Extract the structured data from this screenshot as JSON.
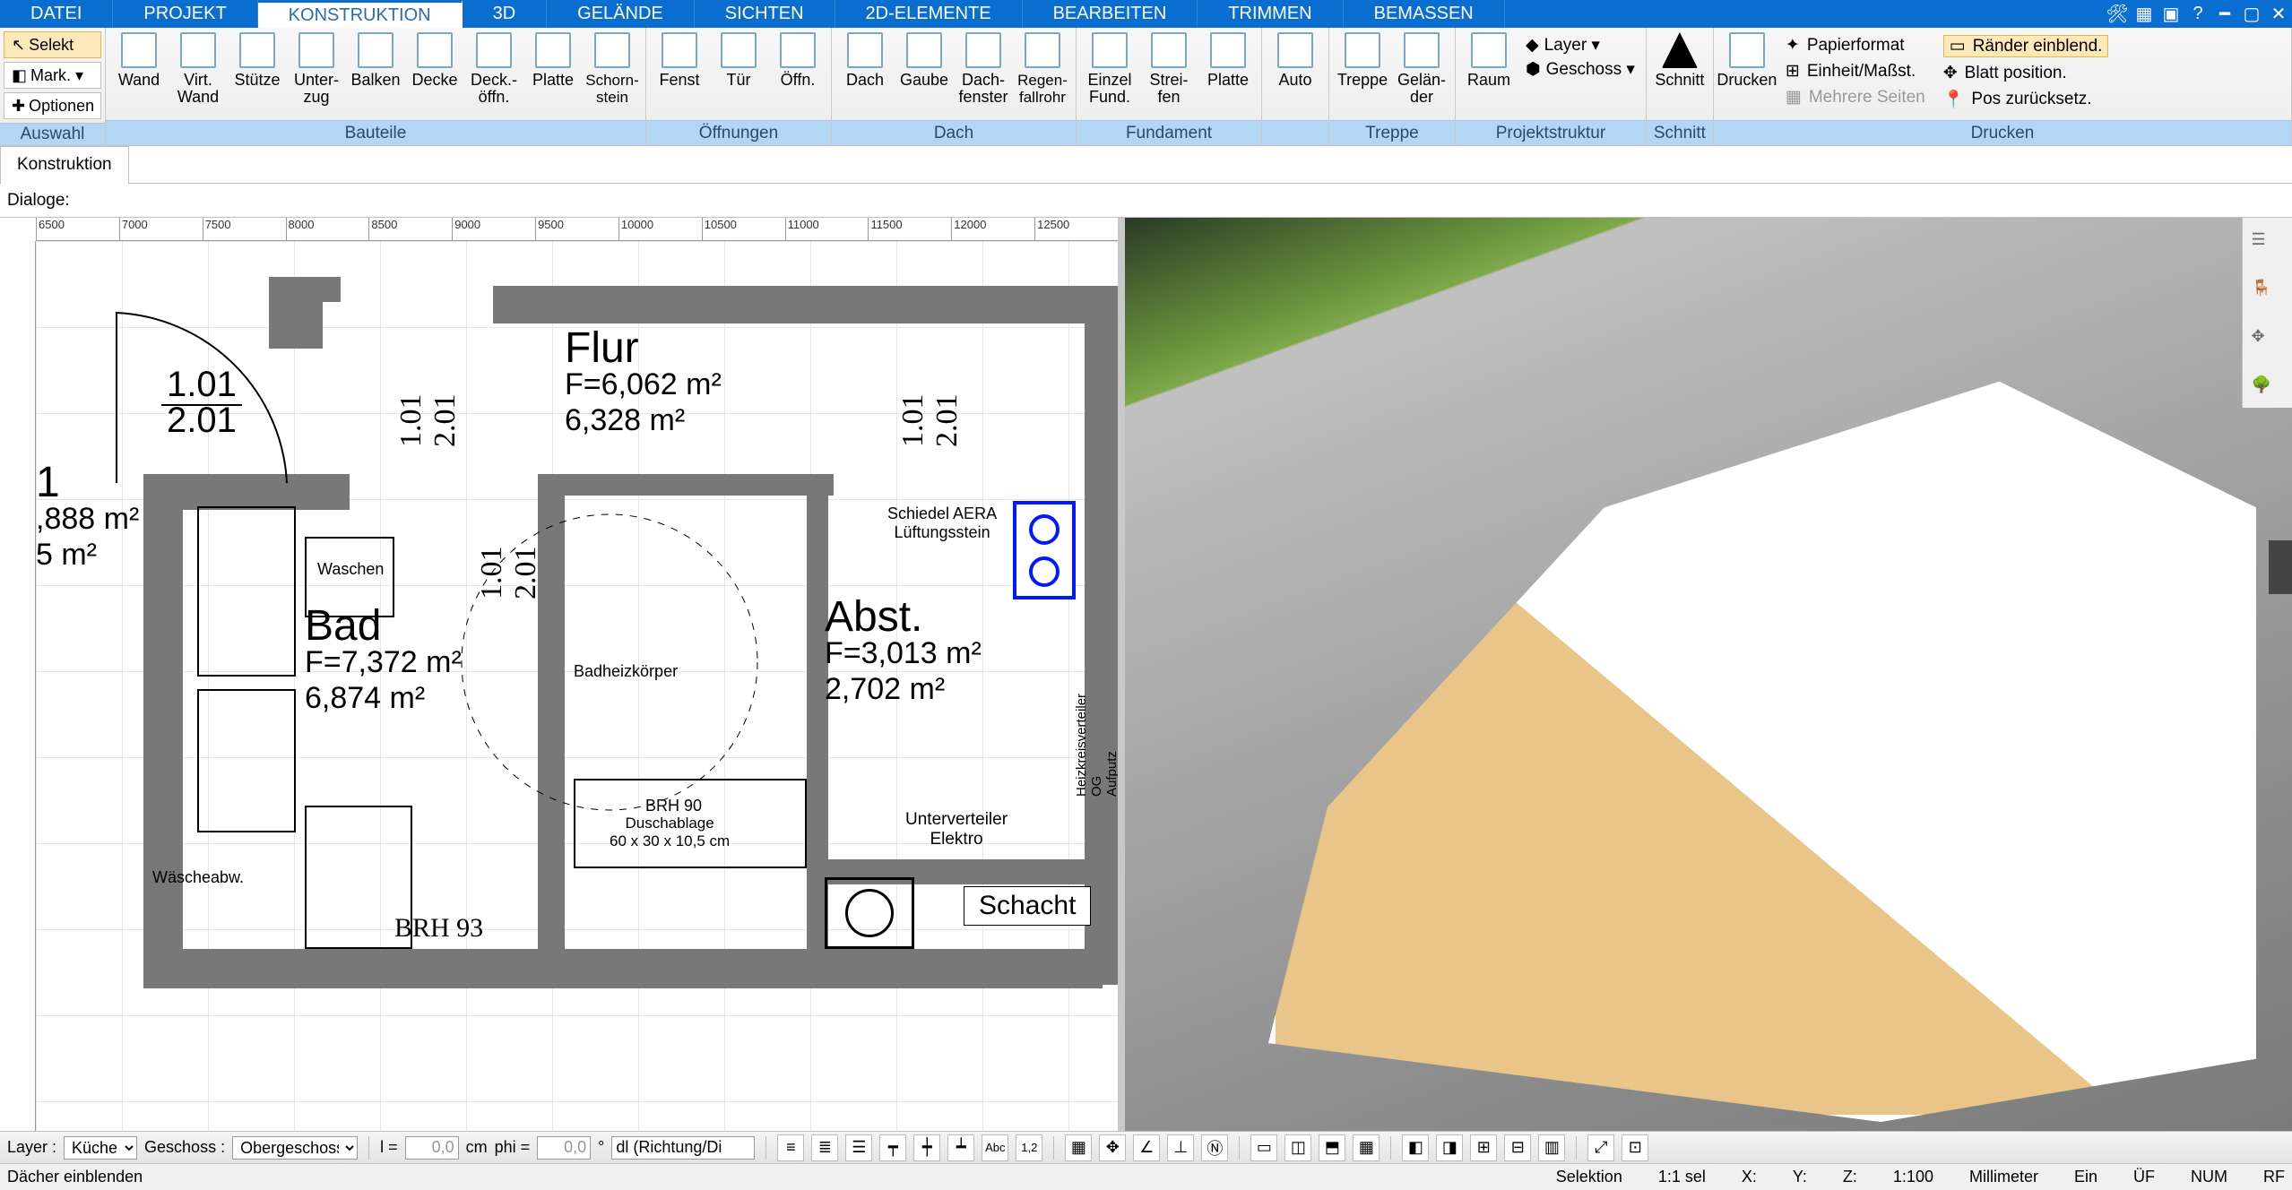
{
  "tabs": [
    "DATEI",
    "PROJEKT",
    "KONSTRUKTION",
    "3D",
    "GELÄNDE",
    "SICHTEN",
    "2D-ELEMENTE",
    "BEARBEITEN",
    "TRIMMEN",
    "BEMASSEN"
  ],
  "active_tab": 2,
  "auswahl": {
    "selekt": "Selekt",
    "mark": "Mark. ▾",
    "optionen": "Optionen",
    "group": "Auswahl"
  },
  "groups": {
    "bauteile": {
      "label": "Bauteile",
      "items": [
        "Wand",
        "Virt.\nWand",
        "Stütze",
        "Unter-\nzug",
        "Balken",
        "Decke",
        "Deck.-\nöffn.",
        "Platte",
        "Schorn-\nstein"
      ]
    },
    "oeffnungen": {
      "label": "Öffnungen",
      "items": [
        "Fenst",
        "Tür",
        "Öffn."
      ]
    },
    "dach": {
      "label": "Dach",
      "items": [
        "Dach",
        "Gaube",
        "Dach-\nfenster",
        "Regen-\nfallrohr"
      ]
    },
    "fundament": {
      "label": "Fundament",
      "items": [
        "Einzel\nFund.",
        "Strei-\nfen",
        "Platte"
      ]
    },
    "auto": {
      "label": " ",
      "items": [
        "Auto"
      ]
    },
    "treppe": {
      "label": "Treppe",
      "items": [
        "Treppe",
        "Gelän-\nder"
      ]
    },
    "projekt": {
      "label": "Projektstruktur",
      "items": [
        "Raum"
      ],
      "layers": [
        "Layer ▾",
        "Geschoss ▾"
      ]
    },
    "schnitt": {
      "label": "Schnitt",
      "items": [
        "Schnitt"
      ]
    },
    "drucken": {
      "label": "Drucken",
      "items": [
        "Drucken"
      ],
      "opts": [
        "Papierformat",
        "Einheit/Maßst.",
        "Mehrere Seiten"
      ],
      "opts2": [
        "Ränder einblend.",
        "Blatt position.",
        "Pos zurücksetz."
      ]
    }
  },
  "subtab": "Konstruktion",
  "dialogs_label": "Dialoge:",
  "ruler": [
    "6500",
    "7000",
    "7500",
    "8000",
    "8500",
    "9000",
    "9500",
    "10000",
    "10500",
    "11000",
    "11500",
    "12000",
    "12500"
  ],
  "rooms": {
    "flur": {
      "name": "Flur",
      "l1": "F=6,062 m²",
      "l2": "6,328 m²"
    },
    "bad": {
      "name": "Bad",
      "l1": "F=7,372 m²",
      "l2": "6,874 m²"
    },
    "abst": {
      "name": "Abst.",
      "l1": "F=3,013 m²",
      "l2": "2,702 m²"
    },
    "cut": {
      "a": "1",
      "b": ",888 m²",
      "c": "5 m²"
    },
    "schacht": "Schacht",
    "nums": "1.01\n2.01"
  },
  "labels": {
    "vent": "Schiedel AERA\nLüftungsstein",
    "uvert": "Unterverteiler\nElektro",
    "waschen": "Waschen",
    "waesche": "Wäscheabw.",
    "brh93": "BRH 93",
    "brh90": "BRH 90",
    "dusch": "Duschablage\n60 x 30 x 10,5 cm",
    "bhk": "Badheizkörper",
    "hkv": "Heizkreisverteiler OG\nAufputz"
  },
  "toolbar": {
    "layer_lbl": "Layer :",
    "layer_val": "Küche",
    "geschoss_lbl": "Geschoss :",
    "geschoss_val": "Obergeschoss",
    "l_lbl": "l =",
    "l_val": "0,0",
    "l_unit": "cm",
    "phi_lbl": "phi =",
    "phi_val": "0,0",
    "phi_unit": "°",
    "dl": "dl (Richtung/Di"
  },
  "status": {
    "left": "Dächer einblenden",
    "sel": "Selektion",
    "ratio": "1:1 sel",
    "x": "X:",
    "y": "Y:",
    "z": "Z:",
    "scale": "1:100",
    "unit": "Millimeter",
    "ein": "Ein",
    "uf": "ÜF",
    "num": "NUM",
    "rf": "RF"
  }
}
